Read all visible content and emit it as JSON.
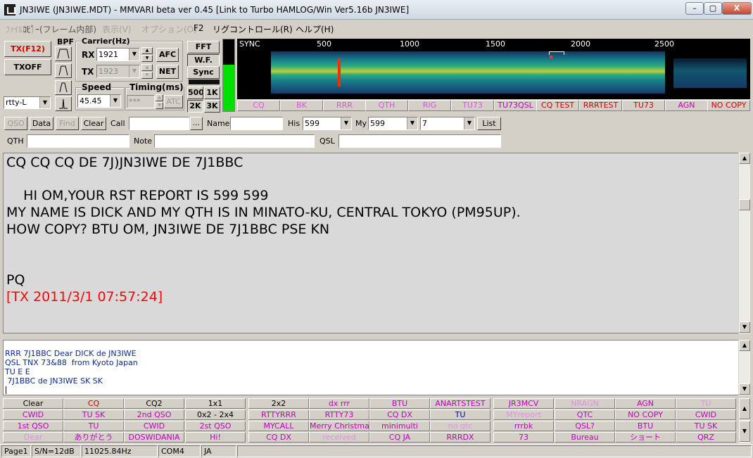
{
  "window": {
    "title": "JN3IWE (JN3IWE.MDT) - MMVARI beta ver 0.45 [Link to Turbo HAMLOG/Win Ver5.16b JN3IWE]",
    "min": "–",
    "max": "▢",
    "close": "X"
  },
  "menu": [
    "ﾌｧｲﾙ(F)",
    "ｺﾋﾟｰ(フレーム内部)",
    "表示(V)",
    "オプション(O)",
    "F2",
    "リグコントロール(R)",
    "ヘルプ(H)"
  ],
  "tx_panel": {
    "tx": "TX(F12)",
    "txoff": "TXOFF",
    "mode": "rtty-L"
  },
  "bpf": {
    "label": "BPF"
  },
  "carrier": {
    "label": "Carrier(Hz)",
    "rx_label": "RX",
    "rx_value": "1921",
    "tx_label": "TX",
    "tx_value": "1923",
    "afc": "AFC",
    "net": "NET"
  },
  "speed": {
    "label": "Speed",
    "value": "45.45"
  },
  "timing": {
    "label": "Timing(ms)",
    "value": "***",
    "atc": "ATC"
  },
  "view": {
    "fft": "FFT",
    "wf": "W.F.",
    "sync": "Sync",
    "b500": "500",
    "b1k": "1K",
    "b2k": "2K",
    "b3k": "3K"
  },
  "waterfall": {
    "label": "SYNC",
    "ticks": [
      "500",
      "1000",
      "1500",
      "2000",
      "2500"
    ]
  },
  "macros_top": [
    {
      "label": "CQ",
      "color": "#e050e0"
    },
    {
      "label": "BK",
      "color": "#e050e0"
    },
    {
      "label": "RRR",
      "color": "#e050e0"
    },
    {
      "label": "QTH",
      "color": "#e050e0"
    },
    {
      "label": "RIG",
      "color": "#e050e0"
    },
    {
      "label": "TU73",
      "color": "#e050e0"
    },
    {
      "label": "TU73QSL",
      "color": "#c000c0"
    },
    {
      "label": "CQ TEST",
      "color": "#d00000"
    },
    {
      "label": "RRRTEST",
      "color": "#d00000"
    },
    {
      "label": "TU73",
      "color": "#d00000"
    },
    {
      "label": "AGN",
      "color": "#c000c0"
    },
    {
      "label": "NO COPY",
      "color": "#d00000"
    }
  ],
  "log": {
    "qso": "QSO",
    "data": "Data",
    "find": "Find",
    "clear": "Clear",
    "call_label": "Call",
    "call": "",
    "browse": "...",
    "name_label": "Name",
    "name": "",
    "his_label": "His",
    "his": "599",
    "my_label": "My",
    "my": "599",
    "band": "7",
    "list": "List",
    "qth_label": "QTH",
    "qth": "",
    "note_label": "Note",
    "note": "",
    "qsl_label": "QSL",
    "qsl": ""
  },
  "rx_text": {
    "line1": "CQ CQ CQ DE 7J)JN3IWE DE 7J1BBC",
    "line2": "    HI OM,YOUR RST REPORT IS 599 599",
    "line3": "MY NAME IS DICK AND MY QTH IS IN MINATO-KU, CENTRAL TOKYO (PM95UP).",
    "line4": "HOW COPY? BTU OM, JN3IWE DE 7J1BBC PSE KN",
    "line5": "PQ",
    "line6": "[TX 2011/3/1 07:57:24]"
  },
  "tx_text": {
    "line1": "RRR 7J1BBC Dear DICK de JN3IWE",
    "line2": "QSL TNX 73&88  from Kyoto Japan",
    "line3": "TU E E",
    "line4": " 7J1BBC de JN3IWE SK SK"
  },
  "macro_grid": [
    [
      {
        "t": "Clear",
        "c": "#000"
      },
      {
        "t": "CQ",
        "c": "#d00000"
      },
      {
        "t": "CQ2",
        "c": "#000"
      },
      {
        "t": "1x1",
        "c": "#000"
      },
      {
        "t": "2x2",
        "c": "#000"
      },
      {
        "t": "dx rrr",
        "c": "#c000c0"
      },
      {
        "t": "BTU",
        "c": "#c000c0"
      },
      {
        "t": "ANARTSTEST",
        "c": "#c000c0"
      },
      {
        "t": "JR3MCV",
        "c": "#c000c0"
      },
      {
        "t": "NRAGN",
        "c": "#e090e0"
      },
      {
        "t": "AGN",
        "c": "#c000c0"
      },
      {
        "t": "TU",
        "c": "#e090e0"
      }
    ],
    [
      {
        "t": "CWID",
        "c": "#c000c0"
      },
      {
        "t": "TU SK",
        "c": "#c000c0"
      },
      {
        "t": "2nd QSO",
        "c": "#c000c0"
      },
      {
        "t": "0x2 - 2x4",
        "c": "#000"
      },
      {
        "t": "RTTYRRR",
        "c": "#c000c0"
      },
      {
        "t": "RTTY73",
        "c": "#c000c0"
      },
      {
        "t": "CQ DX",
        "c": "#c000c0"
      },
      {
        "t": "TU",
        "c": "#0000c0"
      },
      {
        "t": "MYreport",
        "c": "#e090e0"
      },
      {
        "t": "QTC",
        "c": "#c000c0"
      },
      {
        "t": "NO COPY",
        "c": "#c000c0"
      },
      {
        "t": "CWID",
        "c": "#c000c0"
      }
    ],
    [
      {
        "t": "1st QSO",
        "c": "#c000c0"
      },
      {
        "t": "TU",
        "c": "#c000c0"
      },
      {
        "t": "CWID",
        "c": "#c000c0"
      },
      {
        "t": "2st QSO",
        "c": "#c000c0"
      },
      {
        "t": "MYCALL",
        "c": "#c000c0"
      },
      {
        "t": "Merry Christmas",
        "c": "#c000c0"
      },
      {
        "t": "minimulti",
        "c": "#c000c0"
      },
      {
        "t": "no qtc",
        "c": "#e090e0"
      },
      {
        "t": "rrrbk",
        "c": "#c000c0"
      },
      {
        "t": "QSL?",
        "c": "#c000c0"
      },
      {
        "t": "BTU",
        "c": "#c000c0"
      },
      {
        "t": "TU SK",
        "c": "#c000c0"
      }
    ],
    [
      {
        "t": "Dear",
        "c": "#e090e0"
      },
      {
        "t": "ありがとう",
        "c": "#c000c0"
      },
      {
        "t": "DOSWIDANIA",
        "c": "#c000c0"
      },
      {
        "t": "Hi!",
        "c": "#c000c0"
      },
      {
        "t": "CQ DX",
        "c": "#c000c0"
      },
      {
        "t": "received",
        "c": "#e090e0"
      },
      {
        "t": "CQ JA",
        "c": "#c000c0"
      },
      {
        "t": "RRRDX",
        "c": "#c000c0"
      },
      {
        "t": "73",
        "c": "#c000c0"
      },
      {
        "t": "Bureau",
        "c": "#c000c0"
      },
      {
        "t": "ショート",
        "c": "#c000c0"
      },
      {
        "t": "QRZ",
        "c": "#c000c0"
      }
    ]
  ],
  "status": {
    "page": "Page1",
    "sn": "S/N=12dB",
    "clock": "11025.84Hz",
    "com": "COM4",
    "lang": "JA"
  }
}
